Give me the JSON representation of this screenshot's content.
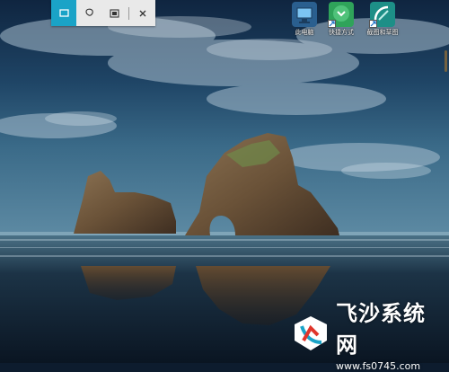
{
  "toolbar": {
    "tools": [
      {
        "icon": "rectangular-snip-icon",
        "active": true
      },
      {
        "icon": "freeform-snip-icon",
        "active": false
      },
      {
        "icon": "fullscreen-snip-icon",
        "active": false
      }
    ],
    "close_icon": "close-icon",
    "accent": "#1aa3c7"
  },
  "desktop_icons": [
    {
      "label": "此电脑",
      "icon": "computer-icon",
      "color": "#2f7fc9"
    },
    {
      "label": "快捷方式",
      "icon": "app-icon",
      "color": "#2fa35a"
    },
    {
      "label": "截图和草图",
      "icon": "snip-sketch-icon",
      "color": "#1d8f87"
    }
  ],
  "watermark": {
    "title": "飞沙系统网",
    "url": "www.fs0745.com"
  }
}
